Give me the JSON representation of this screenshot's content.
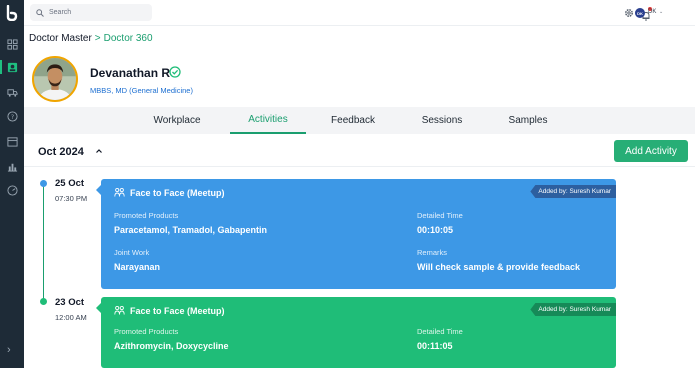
{
  "topbar": {
    "search_placeholder": "Search",
    "user_initials": "DK",
    "avatar_text": "DK"
  },
  "breadcrumb": {
    "root": "Doctor Master",
    "separator": ">",
    "current": "Doctor 360"
  },
  "doctor": {
    "name": "Devanathan R",
    "degree": "MBBS, MD (General Medicine)",
    "verified": true
  },
  "tabs": [
    {
      "label": "Workplace",
      "active": false
    },
    {
      "label": "Activities",
      "active": true
    },
    {
      "label": "Feedback",
      "active": false
    },
    {
      "label": "Sessions",
      "active": false
    },
    {
      "label": "Samples",
      "active": false
    }
  ],
  "month_label": "Oct 2024",
  "add_activity_label": "Add Activity",
  "colors": {
    "accent": "#1a9e6f",
    "card_blue": "#3d98e6",
    "card_green": "#1fbd78",
    "sidebar": "#1e2b37"
  },
  "activities": [
    {
      "date": "25 Oct",
      "time": "07:30 PM",
      "dot_color": "#3d98e6",
      "type": "Face to Face (Meetup)",
      "added_by": "Added by: Suresh Kumar",
      "promoted_products_label": "Promoted Products",
      "promoted_products": "Paracetamol, Tramadol, Gabapentin",
      "detailed_time_label": "Detailed Time",
      "detailed_time": "00:10:05",
      "joint_work_label": "Joint Work",
      "joint_work": "Narayanan",
      "remarks_label": "Remarks",
      "remarks": "Will check sample & provide feedback"
    },
    {
      "date": "23 Oct",
      "time": "12:00 AM",
      "dot_color": "#1fbd78",
      "type": "Face to Face (Meetup)",
      "added_by": "Added by: Suresh Kumar",
      "promoted_products_label": "Promoted Products",
      "promoted_products": "Azithromycin, Doxycycline",
      "detailed_time_label": "Detailed Time",
      "detailed_time": "00:11:05"
    }
  ],
  "sidebar_icons": [
    "logo-icon",
    "dashboard-icon",
    "doctor-icon",
    "truck-icon",
    "help-icon",
    "calendar-icon",
    "chart-icon",
    "gauge-icon",
    "expand-icon"
  ]
}
